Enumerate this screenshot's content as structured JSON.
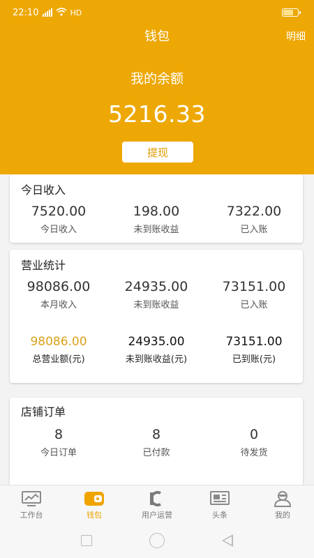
{
  "status_bar": {
    "time": "22:10",
    "network": "HD"
  },
  "header": {
    "title": "钱包",
    "detail_link": "明细",
    "balance_label": "我的余额",
    "balance": "5216.33",
    "withdraw_label": "提现"
  },
  "today_income": {
    "title": "今日收入",
    "stats": [
      {
        "value": "7520.00",
        "label": "今日收入"
      },
      {
        "value": "198.00",
        "label": "未到账收益"
      },
      {
        "value": "7322.00",
        "label": "已入账"
      }
    ]
  },
  "business_stats": {
    "title": "营业统计",
    "monthly": [
      {
        "value": "98086.00",
        "label": "本月收入"
      },
      {
        "value": "24935.00",
        "label": "未到账收益"
      },
      {
        "value": "73151.00",
        "label": "已入账"
      }
    ],
    "totals": [
      {
        "value": "98086.00",
        "label": "总营业额(元)"
      },
      {
        "value": "24935.00",
        "label": "未到账收益(元)"
      },
      {
        "value": "73151.00",
        "label": "已到账(元)"
      }
    ]
  },
  "store_orders": {
    "title": "店铺订单",
    "stats": [
      {
        "value": "8",
        "label": "今日订单"
      },
      {
        "value": "8",
        "label": "已付款"
      },
      {
        "value": "0",
        "label": "待发货"
      }
    ]
  },
  "tabbar": {
    "tabs": [
      {
        "label": "工作台",
        "icon": "dashboard-icon"
      },
      {
        "label": "钱包",
        "icon": "wallet-icon"
      },
      {
        "label": "用户运营",
        "icon": "user-ops-icon"
      },
      {
        "label": "头条",
        "icon": "news-icon"
      },
      {
        "label": "我的",
        "icon": "profile-icon"
      }
    ],
    "active_index": 1
  },
  "colors": {
    "accent": "#eda806",
    "gold_text": "#d9a21b",
    "active_tab": "#e9a500"
  }
}
